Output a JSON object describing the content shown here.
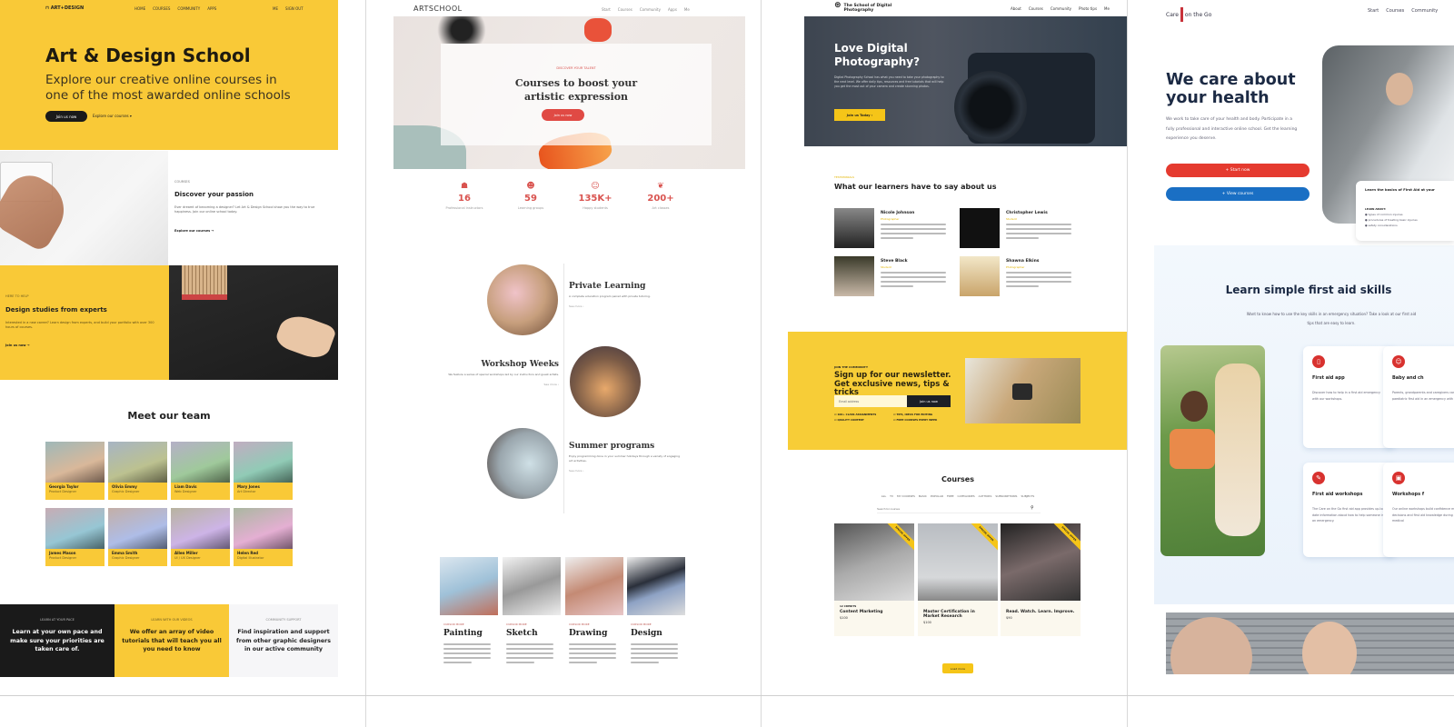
{
  "colors": {
    "yellow": "#f9c937",
    "dark": "#1a1a1a",
    "red": "#e53a2f",
    "blue": "#1a6fc4",
    "artschool_red": "#d9534f"
  },
  "site1": {
    "logo": "ART+DESIGN",
    "nav": [
      "HOME",
      "COURSES",
      "COMMUNITY",
      "APPS"
    ],
    "nav_right": [
      "ME",
      "SIGN OUT"
    ],
    "hero_title": "Art & Design School",
    "hero_subtitle": "Explore our creative online courses in one of the most awarded online schools",
    "primary_button": "Join us now",
    "secondary_link": "Explore our courses",
    "section1": {
      "eyebrow": "COURSES",
      "title": "Discover your passion",
      "text": "Ever dreamt of becoming a designer? Let Art & Design School show you the way to true happiness. Join our online school today.",
      "link": "Explore our courses"
    },
    "section2": {
      "eyebrow": "HERE TO HELP",
      "title": "Design studies from experts",
      "text": "Interested in a new career? Learn design from experts, and build your portfolio with over 300 hours of courses.",
      "link": "Join us now"
    },
    "team_title": "Meet our team",
    "team": [
      {
        "name": "Georgia Taylor",
        "role": "Product Designer"
      },
      {
        "name": "Olivia Emmy",
        "role": "Graphic Designer"
      },
      {
        "name": "Liam Davis",
        "role": "Web Designer"
      },
      {
        "name": "Mary Jones",
        "role": "Art Director"
      },
      {
        "name": "James Mason",
        "role": "Product Designer"
      },
      {
        "name": "Emma Smith",
        "role": "Graphic Designer"
      },
      {
        "name": "Allen Miller",
        "role": "UI / UX Designer"
      },
      {
        "name": "Helen Red",
        "role": "Digital Illustrator"
      }
    ],
    "features": [
      {
        "eyebrow": "LEARN AT YOUR PACE",
        "text": "Learn at your own pace and make sure your priorities are taken care of."
      },
      {
        "eyebrow": "LEARN WITH OUR VIDEOS",
        "text": "We offer an array of video tutorials that will teach you all you need to know"
      },
      {
        "eyebrow": "COMMUNITY SUPPORT",
        "text": "Find inspiration and support from other graphic designers in our active community"
      }
    ]
  },
  "site2": {
    "logo": "ARTSCHOOL",
    "nav": [
      "Start",
      "Courses",
      "Community",
      "Apps",
      "Me"
    ],
    "hero_eyebrow": "DISCOVER YOUR TALENT",
    "hero_title": "Courses to boost your artistic expression",
    "hero_button": "Join us now",
    "stats": [
      {
        "icon": "teacher-icon",
        "glyph": "☗",
        "value": "16",
        "label": "Professional instructors"
      },
      {
        "icon": "group-icon",
        "glyph": "☻",
        "value": "59",
        "label": "Learning groups"
      },
      {
        "icon": "smile-icon",
        "glyph": "☺",
        "value": "135K+",
        "label": "Happy students"
      },
      {
        "icon": "leaf-icon",
        "glyph": "❦",
        "value": "200+",
        "label": "Art classes"
      }
    ],
    "programs": [
      {
        "title": "Private Learning",
        "text": "A complete education program paired with private tutoring.",
        "link": "See more"
      },
      {
        "title": "Workshop Weeks",
        "text": "We feature a series of special workshops led by our instructors and guest artists.",
        "link": "See more"
      },
      {
        "title": "Summer programs",
        "text": "Enjoy programming done in your summer holidays through a variety of engaging art activities.",
        "link": "See more"
      }
    ],
    "courses": [
      {
        "tag": "CURSOR MORE",
        "title": "Painting"
      },
      {
        "tag": "CURSOR MORE",
        "title": "Sketch"
      },
      {
        "tag": "CURSOR MORE",
        "title": "Drawing"
      },
      {
        "tag": "CURSOR MORE",
        "title": "Design"
      }
    ]
  },
  "site3": {
    "logo": "The School of Digital Photography",
    "nav": [
      "About",
      "Courses",
      "Community",
      "Photo tips",
      "Me"
    ],
    "hero_title": "Love Digital Photography?",
    "hero_text": "Digital Photography School has what you need to take your photography to the next level. We offer daily tips, resources and free tutorials that will help you get the most out of your camera and create stunning photos.",
    "hero_button": "Join us Today",
    "testimonials_eyebrow": "TESTIMONIALS",
    "testimonials_title": "What our learners have to say about us",
    "testimonials": [
      {
        "name": "Nicole Johnson",
        "role": "Photographer"
      },
      {
        "name": "Christopher Lewis",
        "role": "Student"
      },
      {
        "name": "Steve Black",
        "role": "Student"
      },
      {
        "name": "Shawna Elkins",
        "role": "Photographer"
      }
    ],
    "newsletter": {
      "eyebrow": "JOIN THE COMMUNITY",
      "title": "Sign up for our newsletter. Get exclusive news, tips & tricks",
      "placeholder": "Email address",
      "button": "Join us now",
      "perks": [
        "100+ CLASS ASSIGNMENTS",
        "TIPS, IDEAS FOR EDITING",
        "QUALITY CONTENT",
        "FREE COURSES EVERY WEEK"
      ]
    },
    "courses_title": "Courses",
    "filters": [
      "ALL",
      "TV",
      "MY COURSES",
      "BASIC",
      "POPULAR",
      "FREE",
      "CATEGORIES",
      "AUTHORS",
      "SUBSCRIPTIONS",
      "SUBJECTS"
    ],
    "search_placeholder": "Search for courses",
    "ribbon": "SPECIAL OFFER",
    "course_cards": [
      {
        "badge": "12 CREDITS",
        "title": "Content Marketing",
        "price": "$100"
      },
      {
        "badge": "",
        "title": "Master Certification in Market Research",
        "price": "$100"
      },
      {
        "badge": "",
        "title": "Read. Watch. Learn. Improve.",
        "price": "$90"
      }
    ],
    "load_more": "Load more"
  },
  "site4": {
    "logo_left": "Care",
    "logo_right": "on the Go",
    "nav": [
      "Start",
      "Courses",
      "Community"
    ],
    "hero_title": "We care about your health",
    "hero_text": "We work to take care of your health and body. Participate in a fully professional and interactive online school. Get the learning experience you deserve.",
    "start_button": "Start now",
    "view_button": "View courses",
    "info_card": {
      "title": "Learn the basics of First Aid at your",
      "label": "LEARN ABOUT:",
      "items": [
        "types of common injuries",
        "procedures of treating basic injuries",
        "safety considerations"
      ]
    },
    "skills_title": "Learn simple first aid skills",
    "skills_text": "Want to know how to use the key skills in an emergency situation? Take a look at our first aid tips that are easy to learn.",
    "cards": [
      {
        "icon": "phone-icon",
        "glyph": "▯",
        "title": "First aid app",
        "text": "Discover how to help in a first aid emergency with our workshops."
      },
      {
        "icon": "baby-icon",
        "glyph": "☺",
        "title": "Baby and ch",
        "text": "Parents, grandparents and caregivers can learn paediatric first aid in an emergency with a child."
      },
      {
        "icon": "pen-icon",
        "glyph": "✎",
        "title": "First aid workshops",
        "text": "The Care on the Go first aid app provides up-to-date information about how to help someone in an emergency."
      },
      {
        "icon": "briefcase-icon",
        "glyph": "▣",
        "title": "Workshops f",
        "text": "Our online workshops build confidence making decisions and first aid knowledge during a medical"
      }
    ]
  }
}
